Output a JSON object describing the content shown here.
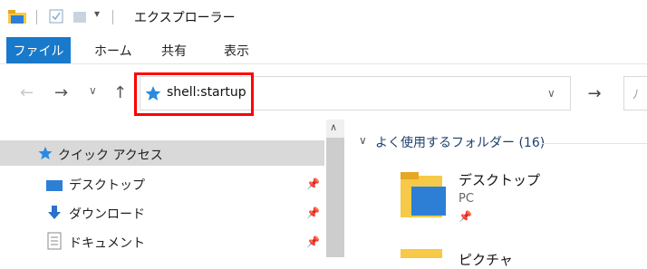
{
  "window": {
    "title": "エクスプローラー"
  },
  "ribbon": {
    "tabs": [
      {
        "label": "ファイル",
        "active": true
      },
      {
        "label": "ホーム"
      },
      {
        "label": "共有"
      },
      {
        "label": "表示"
      }
    ]
  },
  "address_bar": {
    "path": "shell:startup"
  },
  "nav_pane": {
    "quick_access": {
      "label": "クイック アクセス"
    },
    "items": [
      {
        "label": "デスクトップ",
        "pinned": true
      },
      {
        "label": "ダウンロード",
        "pinned": true
      },
      {
        "label": "ドキュメント",
        "pinned": true
      }
    ]
  },
  "content": {
    "group": {
      "label": "よく使用するフォルダー (16)"
    },
    "folders": [
      {
        "name": "デスクトップ",
        "location": "PC"
      },
      {
        "name": "ピクチャ"
      }
    ]
  },
  "colors": {
    "file_tab": "#1979ca",
    "highlight": "#ff0000",
    "selection": "#d9d9d9",
    "folder": "#f7c948"
  }
}
